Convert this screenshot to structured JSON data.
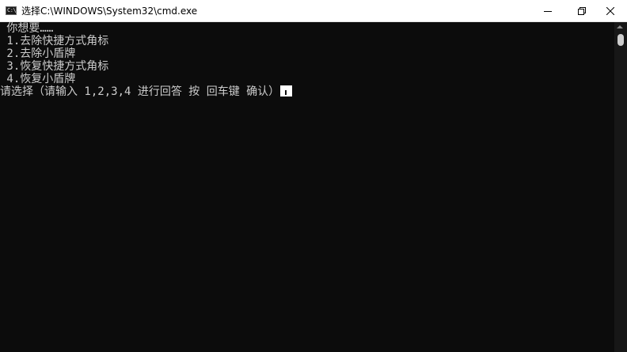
{
  "window": {
    "title": "选择C:\\WINDOWS\\System32\\cmd.exe",
    "icon": "cmd-icon",
    "icon_glyph": "C:\\.",
    "controls": [
      "minimize-icon",
      "restore-icon",
      "close-icon"
    ]
  },
  "console": {
    "lines": [
      " 你想要……",
      " 1.去除快捷方式角标",
      " 2.去除小盾牌",
      " 3.恢复快捷方式角标",
      " 4.恢复小盾牌"
    ],
    "prompt": "请选择（请输入 1,2,3,4 进行回答 按 回车键 确认）"
  },
  "colors": {
    "background": "#0c0c0c",
    "text": "#cccccc",
    "titlebar": "#ffffff",
    "cursor": "#ffffff"
  }
}
